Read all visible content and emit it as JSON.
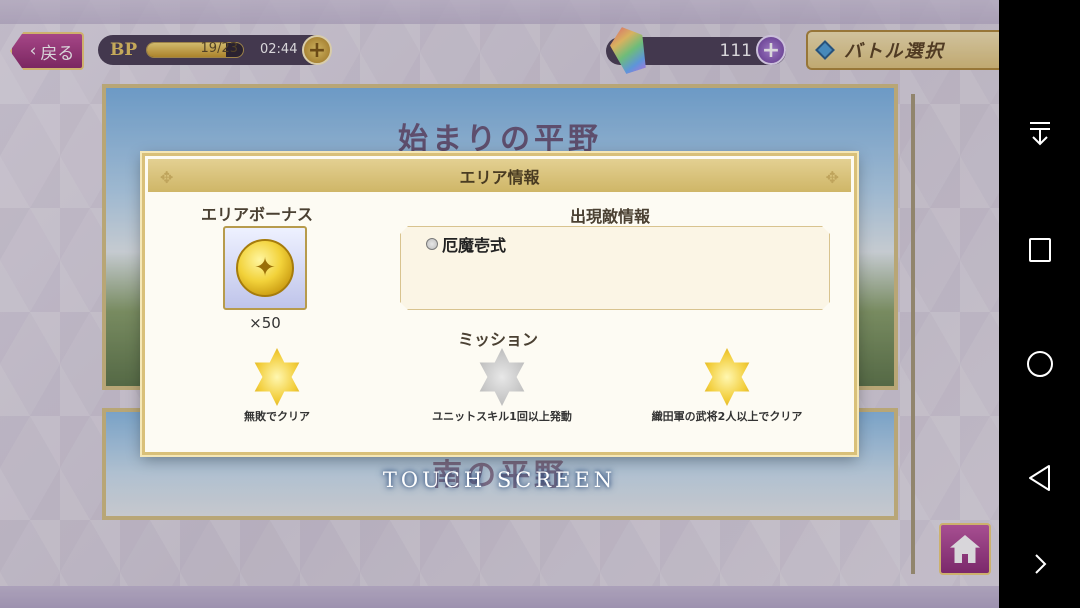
{
  "topbar": {
    "back_label": "戻る",
    "bp_label": "BP",
    "bp_value": "19/23",
    "bp_fill_ratio": 0.826,
    "bp_timer": "02:44",
    "gem_count": "111",
    "battle_select_label": "バトル選択"
  },
  "stages": [
    {
      "title": "始まりの平野"
    },
    {
      "title": "南の平野"
    }
  ],
  "touch_screen": "TOUCH SCREEN",
  "dialog": {
    "title": "エリア情報",
    "bonus_title": "エリアボーナス",
    "bonus_amount": "×50",
    "enemy_title": "出現敵情報",
    "enemies": [
      "厄魔壱式"
    ],
    "mission_title": "ミッション",
    "missions": [
      {
        "label": "無敗でクリア",
        "achieved": true
      },
      {
        "label": "ユニットスキル1回以上発動",
        "achieved": false
      },
      {
        "label": "織田軍の武将2人以上でクリア",
        "achieved": true
      }
    ]
  },
  "icons": {
    "back": "chevron-left-icon",
    "plus": "plus-icon",
    "gem": "gem-icon",
    "coin": "coin-icon",
    "home": "home-icon"
  },
  "colors": {
    "accent_magenta": "#a13a84",
    "gold": "#d9c079",
    "panel_bg": "#fdfbf3"
  }
}
